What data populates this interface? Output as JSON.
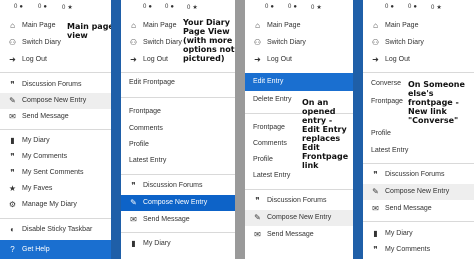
{
  "status_bar": {
    "count": "0",
    "glyph": "●",
    "star": "★"
  },
  "panels": [
    {
      "items": [
        {
          "icon": "⌂",
          "icon_name": "home-icon",
          "label": "Main Page"
        },
        {
          "icon": "⚇",
          "icon_name": "users-icon",
          "label": "Switch Diary"
        },
        {
          "icon": "➜",
          "icon_name": "logout-icon",
          "label": "Log Out"
        },
        {
          "icon": "❞",
          "icon_name": "comments-icon",
          "label": "Discussion Forums"
        },
        {
          "icon": "✎",
          "icon_name": "pencil-icon",
          "label": "Compose New Entry"
        },
        {
          "icon": "✉",
          "icon_name": "envelope-icon",
          "label": "Send Message"
        },
        {
          "icon": "▮",
          "icon_name": "book-icon",
          "label": "My Diary"
        },
        {
          "icon": "❞",
          "icon_name": "comments-icon",
          "label": "My Comments"
        },
        {
          "icon": "❞",
          "icon_name": "comments-icon",
          "label": "My Sent Comments"
        },
        {
          "icon": "★",
          "icon_name": "star-icon",
          "label": "My Faves"
        },
        {
          "icon": "⚙",
          "icon_name": "gear-icon",
          "label": "Manage My Diary"
        },
        {
          "icon": "◐",
          "icon_name": "toggle-icon",
          "label": "Disable Sticky Taskbar"
        },
        {
          "icon": "?",
          "icon_name": "help-icon",
          "label": "Get Help"
        }
      ],
      "annotation": [
        "Main page",
        "view"
      ]
    },
    {
      "items": [
        {
          "icon": "⌂",
          "icon_name": "home-icon",
          "label": "Main Page"
        },
        {
          "icon": "⚇",
          "icon_name": "users-icon",
          "label": "Switch Diary"
        },
        {
          "icon": "➜",
          "icon_name": "logout-icon",
          "label": "Log Out"
        },
        {
          "label": "Edit Frontpage"
        },
        {
          "label": "Frontpage"
        },
        {
          "label": "Comments"
        },
        {
          "label": "Profile"
        },
        {
          "label": "Latest Entry"
        },
        {
          "icon": "❞",
          "icon_name": "comments-icon",
          "label": "Discussion Forums"
        },
        {
          "icon": "✎",
          "icon_name": "pencil-icon",
          "label": "Compose New Entry"
        },
        {
          "icon": "✉",
          "icon_name": "envelope-icon",
          "label": "Send Message"
        },
        {
          "icon": "▮",
          "icon_name": "book-icon",
          "label": "My Diary"
        }
      ],
      "annotation": [
        "Your Diary",
        "Page View",
        "(with more",
        "options not",
        "pictured)"
      ]
    },
    {
      "items": [
        {
          "icon": "⌂",
          "icon_name": "home-icon",
          "label": "Main Page"
        },
        {
          "icon": "⚇",
          "icon_name": "users-icon",
          "label": "Switch Diary"
        },
        {
          "icon": "➜",
          "icon_name": "logout-icon",
          "label": "Log Out"
        },
        {
          "label": "Edit Entry"
        },
        {
          "label": "Delete Entry"
        },
        {
          "label": "Frontpage"
        },
        {
          "label": "Comments"
        },
        {
          "label": "Profile"
        },
        {
          "label": "Latest Entry"
        },
        {
          "icon": "❞",
          "icon_name": "comments-icon",
          "label": "Discussion Forums"
        },
        {
          "icon": "✎",
          "icon_name": "pencil-icon",
          "label": "Compose New Entry"
        },
        {
          "icon": "✉",
          "icon_name": "envelope-icon",
          "label": "Send Message"
        }
      ],
      "annotation": [
        "On an",
        "opened",
        "entry -",
        "Edit Entry",
        "replaces",
        "Edit",
        "Frontpage",
        "link"
      ]
    },
    {
      "items": [
        {
          "icon": "⌂",
          "icon_name": "home-icon",
          "label": "Main Page"
        },
        {
          "icon": "⚇",
          "icon_name": "users-icon",
          "label": "Switch Diary"
        },
        {
          "icon": "➜",
          "icon_name": "logout-icon",
          "label": "Log Out"
        },
        {
          "label": "Converse"
        },
        {
          "label": "Frontpage"
        },
        {
          "label": "Profile"
        },
        {
          "label": "Latest Entry"
        },
        {
          "icon": "❞",
          "icon_name": "comments-icon",
          "label": "Discussion Forums"
        },
        {
          "icon": "✎",
          "icon_name": "pencil-icon",
          "label": "Compose New Entry"
        },
        {
          "icon": "✉",
          "icon_name": "envelope-icon",
          "label": "Send Message"
        },
        {
          "icon": "▮",
          "icon_name": "book-icon",
          "label": "My Diary"
        },
        {
          "icon": "❞",
          "icon_name": "comments-icon",
          "label": "My Comments"
        }
      ],
      "annotation": [
        "On Someone",
        "else's",
        "frontpage -",
        "New link",
        "\"Converse\""
      ]
    }
  ]
}
